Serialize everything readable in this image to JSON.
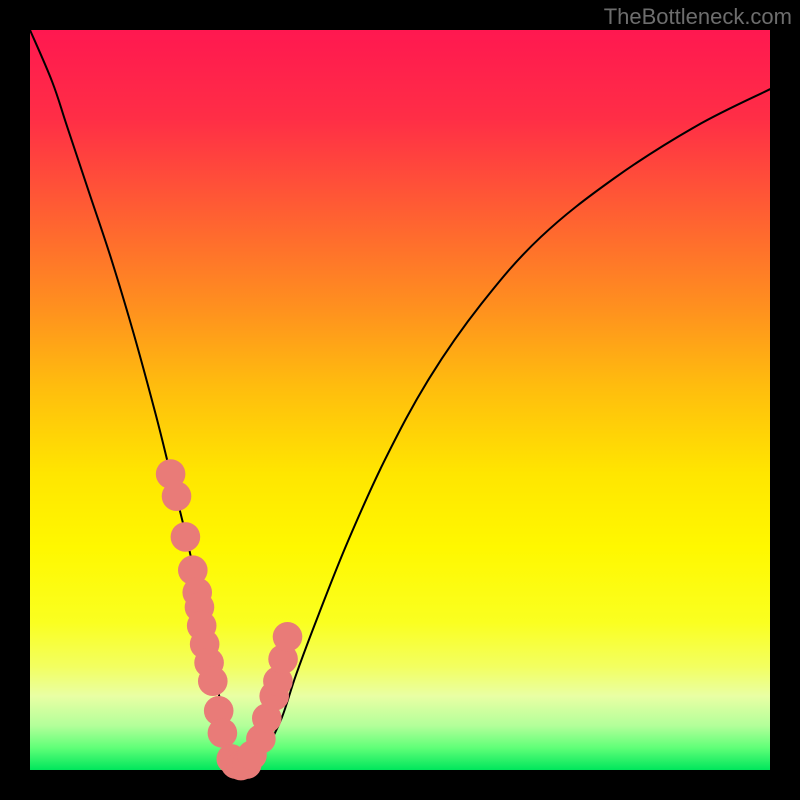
{
  "watermark": "TheBottleneck.com",
  "chart_data": {
    "type": "line",
    "title": "",
    "xlabel": "",
    "ylabel": "",
    "xlim": [
      0,
      100
    ],
    "ylim": [
      0,
      100
    ],
    "background_gradient_stops": [
      {
        "pct": 0,
        "color": "#ff1850"
      },
      {
        "pct": 12,
        "color": "#ff2e46"
      },
      {
        "pct": 25,
        "color": "#ff6032"
      },
      {
        "pct": 38,
        "color": "#ff921e"
      },
      {
        "pct": 48,
        "color": "#ffbc0e"
      },
      {
        "pct": 60,
        "color": "#ffe600"
      },
      {
        "pct": 70,
        "color": "#fff800"
      },
      {
        "pct": 80,
        "color": "#faff20"
      },
      {
        "pct": 86,
        "color": "#f3ff60"
      },
      {
        "pct": 90,
        "color": "#e9ffa4"
      },
      {
        "pct": 94,
        "color": "#b3ff9a"
      },
      {
        "pct": 97,
        "color": "#60ff78"
      },
      {
        "pct": 100,
        "color": "#00e65c"
      }
    ],
    "series": [
      {
        "name": "bottleneck-curve",
        "type": "line",
        "color": "#000000",
        "x": [
          0,
          3,
          5,
          8,
          11,
          14,
          17,
          19,
          21,
          23,
          24.5,
          26,
          27,
          28,
          29,
          30.5,
          32,
          34,
          36,
          39,
          43,
          48,
          54,
          61,
          69,
          79,
          90,
          100
        ],
        "y": [
          100,
          93,
          87,
          78,
          69,
          59,
          48,
          40,
          32,
          23,
          15,
          8,
          3,
          0.5,
          0,
          1,
          3,
          7,
          13,
          21,
          31,
          42,
          53,
          63,
          72,
          80,
          87,
          92
        ]
      },
      {
        "name": "marker-cluster",
        "type": "scatter",
        "color": "#e97b78",
        "radius": 2.0,
        "x": [
          19.0,
          19.8,
          21.0,
          22.0,
          22.6,
          22.9,
          23.2,
          23.6,
          24.2,
          24.7,
          25.5,
          26.0,
          27.2,
          27.8,
          28.5,
          29.3,
          30.0,
          31.2,
          32.0,
          33.0,
          33.5,
          34.2,
          34.8
        ],
        "y": [
          40.0,
          37.0,
          31.5,
          27.0,
          24.0,
          22.0,
          19.5,
          17.0,
          14.5,
          12.0,
          8.0,
          5.0,
          1.5,
          0.8,
          0.6,
          0.8,
          2.0,
          4.2,
          7.0,
          10.0,
          12.0,
          15.0,
          18.0
        ]
      }
    ]
  }
}
